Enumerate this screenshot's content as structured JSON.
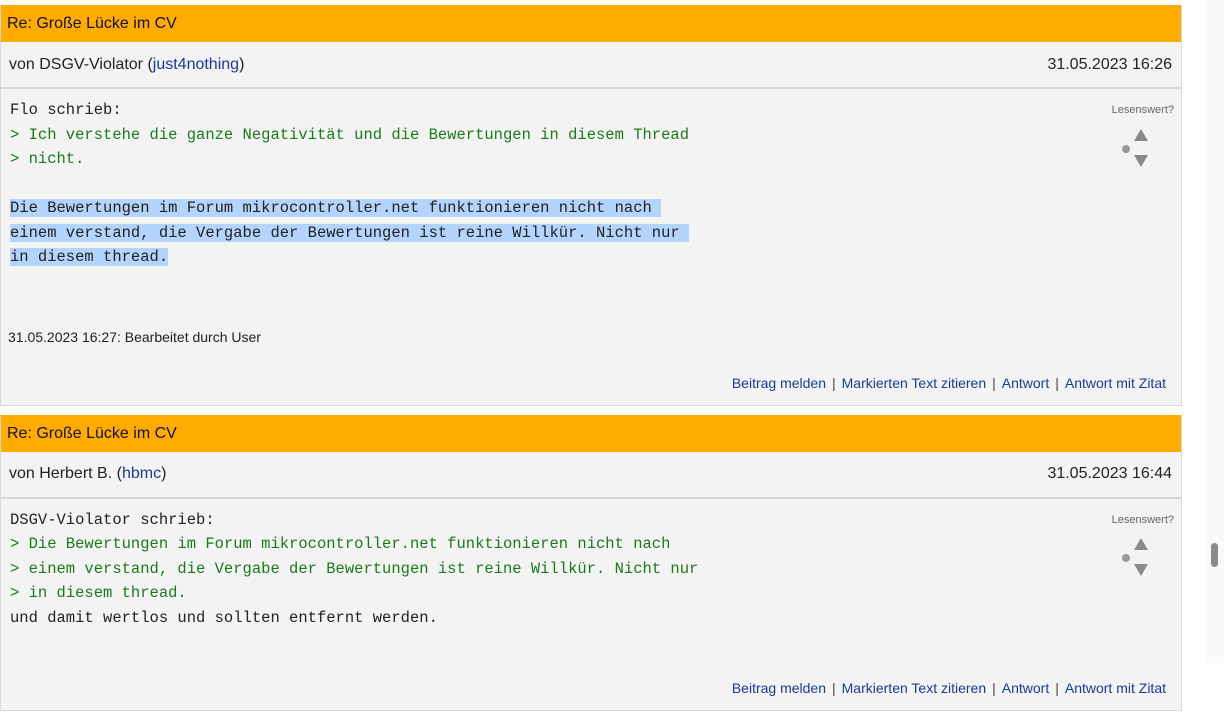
{
  "posts": [
    {
      "title": "Re: Große Lücke im CV",
      "author_prefix": "von DSGV-Violator (",
      "username": "just4nothing",
      "author_suffix": ")",
      "timestamp": "31.05.2023 16:26",
      "rating_label": "Lesenswert?",
      "quote_header": "Flo schrieb:",
      "quote_lines": [
        "> Ich verstehe die ganze Negativität und die Bewertungen in diesem Thread",
        "> nicht."
      ],
      "body_lines": [
        "Die Bewertungen im Forum mikrocontroller.net funktionieren nicht nach ",
        "einem verstand, die Vergabe der Bewertungen ist reine Willkür. Nicht nur ",
        "in diesem thread."
      ],
      "edited_note": "31.05.2023 16:27: Bearbeitet durch User"
    },
    {
      "title": "Re: Große Lücke im CV",
      "author_prefix": "von Herbert B. (",
      "username": "hbmc",
      "author_suffix": ")",
      "timestamp": "31.05.2023 16:44",
      "rating_label": "Lesenswert?",
      "quote_header": "DSGV-Violator schrieb:",
      "quote_lines": [
        "> Die Bewertungen im Forum mikrocontroller.net funktionieren nicht nach",
        "> einem verstand, die Vergabe der Bewertungen ist reine Willkür. Nicht nur",
        "> in diesem thread."
      ],
      "body_lines": [
        "und damit wertlos und sollten entfernt werden."
      ]
    }
  ],
  "actions": {
    "report": "Beitrag melden",
    "quote_selected": "Markierten Text zitieren",
    "reply": "Antwort",
    "reply_quote": "Antwort mit Zitat",
    "separator": "|"
  },
  "colors": {
    "title_bar": "#ffab00",
    "quote_text": "#1a7a1a",
    "link": "#1a3a9a",
    "selection": "#b3d4fd"
  }
}
